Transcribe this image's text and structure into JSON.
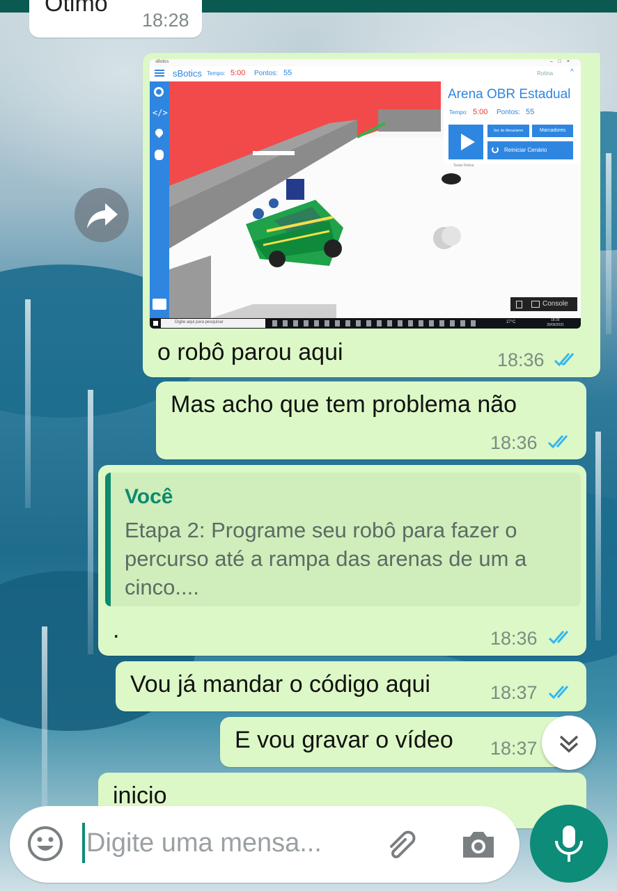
{
  "prev_message": {
    "text": "Ótimo",
    "time": "18:28"
  },
  "image_message": {
    "caption": "o robô parou aqui",
    "time": "18:36",
    "screenshot": {
      "window_title": "sBotics",
      "app_name": "sBotics",
      "tempo_label": "Tempo:",
      "tempo_value": "5:00",
      "pontos_label": "Pontos:",
      "pontos_value": "55",
      "rotina_label": "Rotina",
      "arena_title": "Arena OBR Estadual",
      "btn_sel": "Sel. do Mecanismo",
      "btn_marcadores": "Marcadores",
      "btn_reiniciar": "Reiniciar Cenário",
      "testar_rotina": "Testar Rotina",
      "console_label": "Console",
      "search_placeholder": "Digite aqui para pesquisar",
      "tray_temp": "27°C",
      "tray_time": "18:35",
      "tray_date": "30/06/2021"
    }
  },
  "messages": [
    {
      "text": "Mas acho que tem problema não",
      "time": "18:36"
    },
    {
      "quote_author": "Você",
      "quote_text": "Etapa 2: Programe seu robô para fazer o percurso até a rampa das arenas de um a cinco....",
      "text": ".",
      "time": "18:36"
    },
    {
      "text": "Vou já mandar o código aqui",
      "time": "18:37"
    },
    {
      "text": "E vou gravar o vídeo",
      "time": "18:37"
    },
    {
      "text": "inicio"
    }
  ],
  "composer": {
    "placeholder": "Digite uma mensa..."
  },
  "colors": {
    "outgoing_bubble": "#dcf8c6",
    "read_ticks": "#34b7f1",
    "accent": "#0c8c79",
    "quote_bar": "#0e8a6f"
  },
  "icons": [
    "forward-icon",
    "read-ticks-icon",
    "scroll-down-icon",
    "emoji-icon",
    "attach-icon",
    "camera-icon",
    "mic-icon"
  ]
}
